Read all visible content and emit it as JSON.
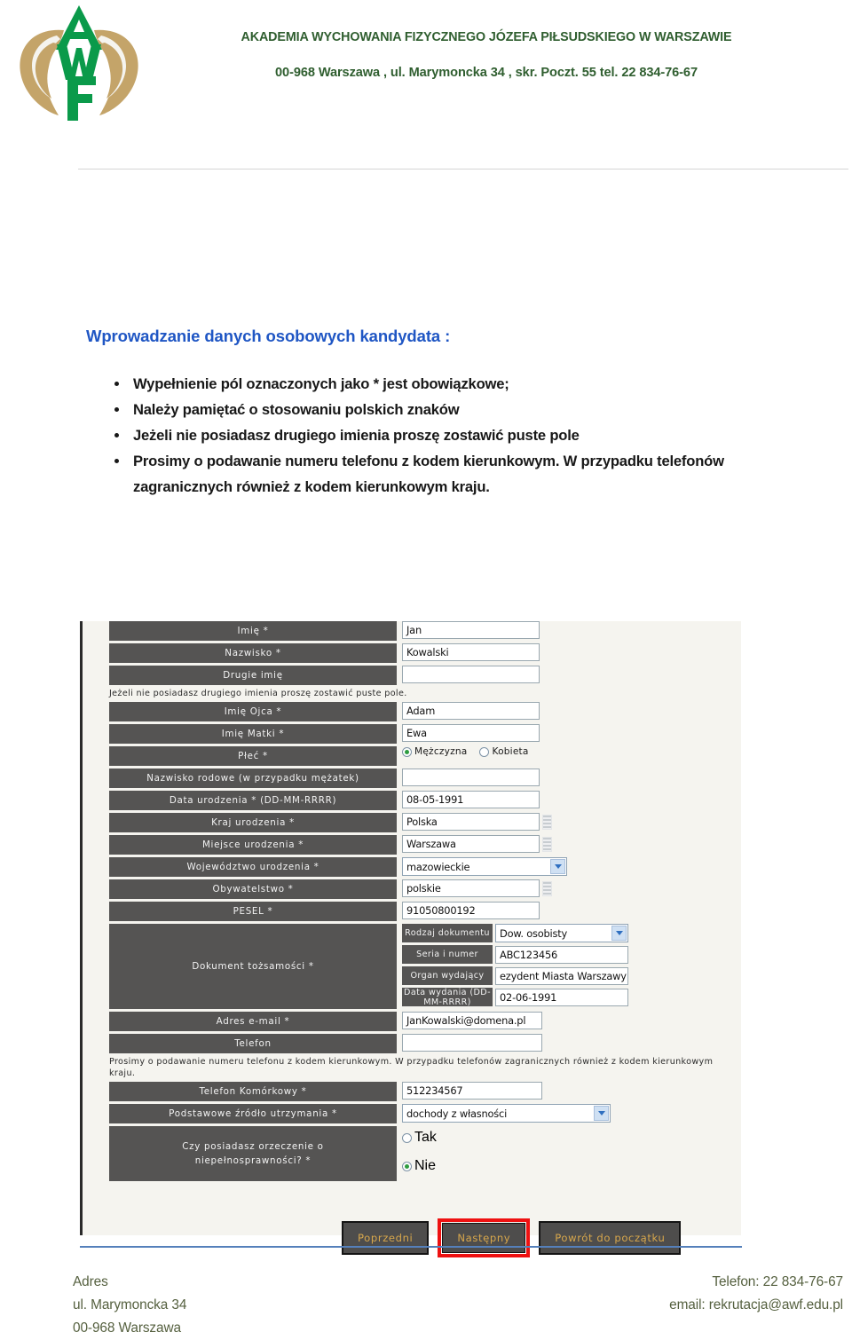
{
  "header": {
    "line1": "AKADEMIA WYCHOWANIA FIZYCZNEGO JÓZEFA PIŁSUDSKIEGO W WARSZAWIE",
    "line2": "00-968 Warszawa , ul. Marymoncka 34 , skr. Poczt. 55 tel. 22 834-76-67",
    "logo_alt": "AWF",
    "colors": {
      "green": "#2f5e2f",
      "gold": "#c4a469"
    }
  },
  "content": {
    "title": "Wprowadzanie danych osobowych kandydata :",
    "bullets": [
      "Wypełnienie pól oznaczonych jako * jest obowiązkowe;",
      "Należy pamiętać o stosowaniu polskich znaków",
      "Jeżeli nie posiadasz drugiego imienia proszę zostawić puste pole",
      "Prosimy o podawanie numeru telefonu z kodem kierunkowym. W przypadku telefonów zagranicznych również z kodem kierunkowym kraju."
    ],
    "title_color": "#1f56c4"
  },
  "form": {
    "rows": [
      {
        "label": "Imię *",
        "value": "Jan",
        "type": "text"
      },
      {
        "label": "Nazwisko *",
        "value": "Kowalski",
        "type": "text"
      },
      {
        "label": "Drugie imię",
        "value": "",
        "type": "text"
      }
    ],
    "hint_second_name": "Jeżeli nie posiadasz drugiego imienia proszę zostawić puste pole.",
    "rows2": [
      {
        "label": "Imię Ojca *",
        "value": "Adam",
        "type": "text"
      },
      {
        "label": "Imię Matki *",
        "value": "Ewa",
        "type": "text"
      }
    ],
    "gender": {
      "label": "Płeć *",
      "options": [
        {
          "text": "Mężczyzna",
          "selected": true
        },
        {
          "text": "Kobieta",
          "selected": false
        }
      ]
    },
    "rows3": [
      {
        "label": "Nazwisko rodowe (w przypadku mężatek)",
        "value": "",
        "type": "text",
        "autocomplete": false
      },
      {
        "label": "Data urodzenia * (DD-MM-RRRR)",
        "value": "08-05-1991",
        "type": "text",
        "autocomplete": false
      },
      {
        "label": "Kraj urodzenia *",
        "value": "Polska",
        "type": "text",
        "autocomplete": true
      },
      {
        "label": "Miejsce urodzenia *",
        "value": "Warszawa",
        "type": "text",
        "autocomplete": true
      }
    ],
    "voivodeship": {
      "label": "Województwo urodzenia *",
      "value": "mazowieckie",
      "type": "select"
    },
    "rows4": [
      {
        "label": "Obywatelstwo *",
        "value": "polskie",
        "type": "text",
        "autocomplete": true
      },
      {
        "label": "PESEL *",
        "value": "91050800192",
        "type": "text",
        "autocomplete": false
      }
    ],
    "document": {
      "label": "Dokument tożsamości *",
      "fields": [
        {
          "label": "Rodzaj dokumentu",
          "value": "Dow. osobisty",
          "type": "select"
        },
        {
          "label": "Seria i numer",
          "value": "ABC123456",
          "type": "text"
        },
        {
          "label": "Organ wydający",
          "value": "ezydent Miasta Warszawy",
          "type": "text"
        },
        {
          "label": "Data wydania (DD-MM-RRRR)",
          "value": "02-06-1991",
          "type": "text"
        }
      ]
    },
    "email": {
      "label": "Adres e-mail *",
      "value": "JanKowalski@domena.pl",
      "type": "text"
    },
    "phone": {
      "label": "Telefon",
      "value": "",
      "type": "text"
    },
    "hint_phone": "Prosimy o podawanie numeru telefonu z kodem kierunkowym. W przypadku telefonów zagranicznych również z kodem kierunkowym kraju.",
    "mobile": {
      "label": "Telefon Komórkowy *",
      "value": "512234567",
      "type": "text"
    },
    "income": {
      "label": "Podstawowe źródło utrzymania *",
      "value": "dochody z własności",
      "type": "select"
    },
    "disability": {
      "label": "Czy posiadasz orzeczenie o niepełnosprawności? *",
      "label_line1": "Czy posiadasz orzeczenie o",
      "label_line2": "niepełnosprawności? *",
      "options": [
        {
          "text": "Tak",
          "selected": false
        },
        {
          "text": "Nie",
          "selected": true
        }
      ]
    },
    "buttons": [
      {
        "text": "Poprzedni",
        "highlighted": false
      },
      {
        "text": "Następny",
        "highlighted": true
      },
      {
        "text": "Powrót do początku",
        "highlighted": false
      }
    ],
    "button_text_color": "#d7a74c",
    "highlight_color": "#ee1111"
  },
  "footer": {
    "left": [
      "Adres",
      "ul. Marymoncka 34",
      "00-968 Warszawa"
    ],
    "right": [
      "Telefon: 22 834-76-67",
      "email: rekrutacja@awf.edu.pl"
    ],
    "color": "#55603f"
  }
}
